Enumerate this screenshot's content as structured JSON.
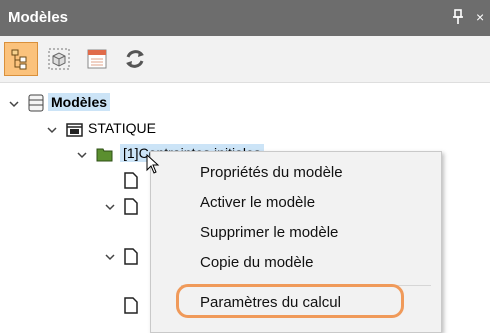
{
  "panel": {
    "title": "Modèles",
    "pin_glyph": "ᵱ",
    "close_glyph": "×"
  },
  "toolbar": {
    "buttons": [
      {
        "icon": "tree-view-icon",
        "active": true
      },
      {
        "icon": "model-3d-icon",
        "active": false
      },
      {
        "icon": "list-window-icon",
        "active": false
      },
      {
        "icon": "refresh-icon",
        "active": false
      }
    ]
  },
  "tree": {
    "root_label": "Modèles",
    "child_label": "STATIQUE",
    "grandchild_label": "[1]Contraintes initiales"
  },
  "context_menu": {
    "items": [
      "Propriétés du modèle",
      "Activer le modèle",
      "Supprimer le modèle",
      "Copie du modèle",
      "Paramètres du calcul"
    ],
    "highlighted_item": "Paramètres du calcul",
    "highlight_color": "#f09a5a"
  }
}
